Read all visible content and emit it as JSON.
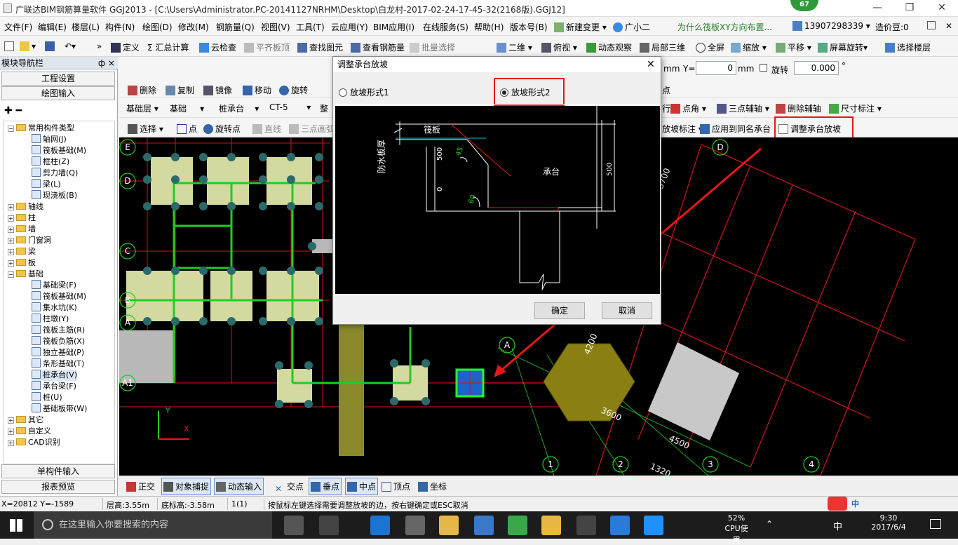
{
  "window": {
    "title": "广联达BIM钢筋算量软件 GGJ2013 - [C:\\Users\\Administrator.PC-20141127NRHM\\Desktop\\白龙村-2017-02-24-17-45-32(2168版).GGJ12]",
    "badge": "67",
    "minimize": "—",
    "restore": "❐",
    "close": "✕"
  },
  "menu": {
    "items": [
      "文件(F)",
      "编辑(E)",
      "楼层(L)",
      "构件(N)",
      "绘图(D)",
      "修改(M)",
      "钢筋量(Q)",
      "视图(V)",
      "工具(T)",
      "云应用(Y)",
      "BIM应用(I)",
      "在线服务(S)",
      "帮助(H)",
      "版本号(B)"
    ],
    "new_change": "新建变更",
    "assistant": "广小二",
    "question": "为什么筏板XY方向布置...",
    "phone": "13907298339",
    "cost_beans": "造价豆:0"
  },
  "toolbar1": {
    "items": [
      "定义",
      "Σ 汇总计算",
      "云检查",
      "平齐板顶",
      "查找图元",
      "查看钢筋量",
      "批量选择",
      "二维",
      "俯视",
      "动态观察",
      "局部三维",
      "全屏",
      "缩放",
      "平移",
      "屏幕旋转",
      "选择楼层"
    ]
  },
  "coord_bar": {
    "mm1": "mm",
    "y_label": "Y=",
    "y_value": "0",
    "mm2": "mm",
    "rotate_label": "旋转",
    "rotate_value": "0.000",
    "degree": "°",
    "right_label": "点"
  },
  "left_panel": {
    "title": "模块导航栏",
    "pin": "ф ×",
    "project_settings": "工程设置",
    "drawing_input": "绘图输入",
    "single_input": "单构件输入",
    "report_preview": "报表预览",
    "tree": [
      {
        "label": "常用构件类型",
        "level": 0
      },
      {
        "label": "轴网(J)",
        "level": 1
      },
      {
        "label": "筏板基础(M)",
        "level": 1
      },
      {
        "label": "框柱(Z)",
        "level": 1
      },
      {
        "label": "剪力墙(Q)",
        "level": 1
      },
      {
        "label": "梁(L)",
        "level": 1
      },
      {
        "label": "现浇板(B)",
        "level": 1
      },
      {
        "label": "轴线",
        "level": 0
      },
      {
        "label": "柱",
        "level": 0
      },
      {
        "label": "墙",
        "level": 0
      },
      {
        "label": "门窗洞",
        "level": 0
      },
      {
        "label": "梁",
        "level": 0
      },
      {
        "label": "板",
        "level": 0
      },
      {
        "label": "基础",
        "level": 0
      },
      {
        "label": "基础梁(F)",
        "level": 1
      },
      {
        "label": "筏板基础(M)",
        "level": 1
      },
      {
        "label": "集水坑(K)",
        "level": 1
      },
      {
        "label": "柱墩(Y)",
        "level": 1
      },
      {
        "label": "筏板主筋(R)",
        "level": 1
      },
      {
        "label": "筏板负筋(X)",
        "level": 1
      },
      {
        "label": "独立基础(P)",
        "level": 1
      },
      {
        "label": "条形基础(T)",
        "level": 1
      },
      {
        "label": "桩承台(V)",
        "level": 1
      },
      {
        "label": "承台梁(F)",
        "level": 1
      },
      {
        "label": "桩(U)",
        "level": 1
      },
      {
        "label": "基础板带(W)",
        "level": 1
      },
      {
        "label": "其它",
        "level": 0
      },
      {
        "label": "自定义",
        "level": 0
      },
      {
        "label": "CAD识别",
        "level": 0
      }
    ]
  },
  "edit_bar": {
    "items": [
      "删除",
      "复制",
      "镜像",
      "移动",
      "旋转"
    ]
  },
  "prop_bar": {
    "floor": "基础层",
    "category": "基础",
    "type": "桩承台",
    "name": "CT-5",
    "extra": "整",
    "right_items": [
      "行",
      "点角",
      "三点辅轴",
      "删除辅轴",
      "尺寸标注"
    ]
  },
  "draw_bar": {
    "items": [
      "选择",
      "点",
      "旋转点",
      "直线",
      "三点画弧"
    ],
    "right_items": [
      "放坡标注",
      "应用到同名承台",
      "调整承台放坡"
    ]
  },
  "dialog": {
    "title": "调整承台放坡",
    "close": "✕",
    "option1": "放坡形式1",
    "option2": "放坡形式2",
    "selected": "放坡形式2",
    "diagram": {
      "raft": "筏板",
      "waterproof": "防水板厚",
      "dim_500_left": "500",
      "angle_45": "45",
      "zero": "0",
      "angle_60": "60",
      "cap": "承台",
      "dim_500_right": "500"
    },
    "ok": "确定",
    "cancel": "取消"
  },
  "canvas_labels": {
    "axis_D": "D",
    "axis_A": "A",
    "axis_1": "1",
    "axis_2": "2",
    "axis_3": "3",
    "axis_4": "4",
    "dim_3700": "3700",
    "dim_4200": "4200",
    "dim_3600": "3600",
    "dim_4500": "4500",
    "dim_1320": "1320",
    "left_E": "E",
    "left_D": "D",
    "left_C": "C",
    "left_B": "B",
    "left_A": "A",
    "left_A1": "A1",
    "y_axis": "Y",
    "x_axis": "X"
  },
  "snap_bar": {
    "items": [
      "正交",
      "对象捕捉",
      "动态输入",
      "交点",
      "垂点",
      "中点",
      "顶点",
      "坐标"
    ]
  },
  "status": {
    "coords": "X=20812 Y=-1589",
    "floor_height": "层高:3.55m",
    "bottom_height": "底标高:-3.58m",
    "count": "1(1)",
    "hint": "按鼠标左键选择需要调整放坡的边，按右键确定或ESC取消"
  },
  "taskbar": {
    "search_placeholder": "在这里输入你要搜索的内容",
    "cpu_pct": "52%",
    "cpu_label": "CPU使用",
    "ime": "中",
    "time": "9:30",
    "date": "2017/6/4"
  },
  "colors": {
    "highlight_red": "#e8161b",
    "cad_bg": "#000000",
    "pile_cap": "#d4d9a0",
    "beam_green": "#22cc22",
    "grid_red": "#d01515"
  }
}
